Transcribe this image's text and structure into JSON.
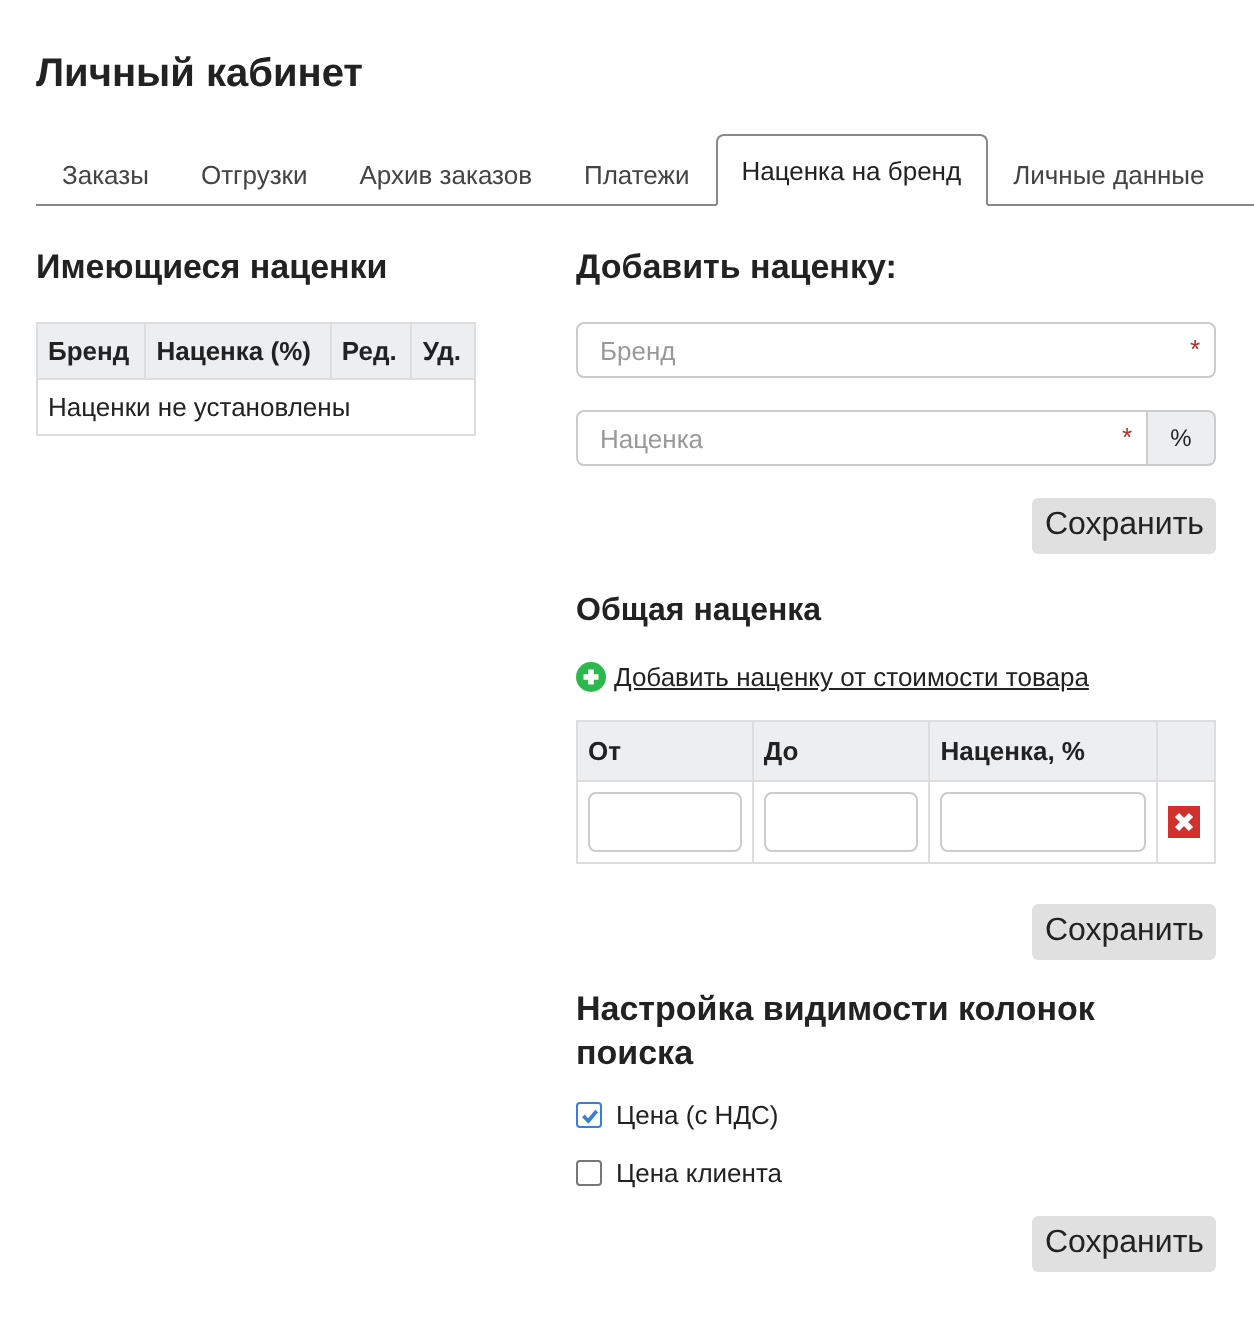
{
  "page_title": "Личный кабинет",
  "tabs": [
    {
      "label": "Заказы",
      "selected": false
    },
    {
      "label": "Отгрузки",
      "selected": false
    },
    {
      "label": "Архив заказов",
      "selected": false
    },
    {
      "label": "Платежи",
      "selected": false
    },
    {
      "label": "Наценка на бренд",
      "selected": true
    },
    {
      "label": "Личные данные",
      "selected": false
    }
  ],
  "existing": {
    "title": "Имеющиеся наценки",
    "columns": [
      "Бренд",
      "Наценка (%)",
      "Ред.",
      "Уд."
    ],
    "empty_text": "Наценки не установлены"
  },
  "add_markup": {
    "title": "Добавить наценку:",
    "brand_field": {
      "placeholder": "Бренд",
      "required_mark": "*"
    },
    "markup_field": {
      "placeholder": "Наценка",
      "required_mark": "*",
      "suffix": "%"
    },
    "save_button": "Сохранить"
  },
  "general_markup": {
    "title": "Общая наценка",
    "add_link": "Добавить наценку от стоимости товара",
    "columns": [
      "От",
      "До",
      "Наценка, %"
    ],
    "rows": [
      {
        "kind": "range"
      }
    ],
    "save_button": "Сохранить"
  },
  "visibility": {
    "title": "Настройка видимости колонок поиска",
    "options": [
      {
        "label": "Цена (с НДС)",
        "checked": true
      },
      {
        "label": "Цена клиента",
        "checked": false
      }
    ],
    "save_button": "Сохранить"
  }
}
